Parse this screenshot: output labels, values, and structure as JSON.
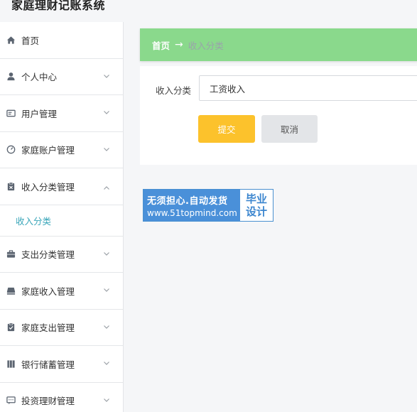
{
  "app": {
    "title": "家庭理财记账系统"
  },
  "sidebar": {
    "items": [
      {
        "label": "首页",
        "icon": "home-icon",
        "has_arrow": false
      },
      {
        "label": "个人中心",
        "icon": "user-icon",
        "has_arrow": true
      },
      {
        "label": "用户管理",
        "icon": "id-card-icon",
        "has_arrow": true
      },
      {
        "label": "家庭账户管理",
        "icon": "gauge-icon",
        "has_arrow": true
      },
      {
        "label": "收入分类管理",
        "icon": "clipboard-icon",
        "has_arrow": true,
        "expanded": true,
        "children": [
          {
            "label": "收入分类"
          }
        ]
      },
      {
        "label": "支出分类管理",
        "icon": "briefcase-icon",
        "has_arrow": true
      },
      {
        "label": "家庭收入管理",
        "icon": "inbox-icon",
        "has_arrow": true
      },
      {
        "label": "家庭支出管理",
        "icon": "clipboard-check-icon",
        "has_arrow": true
      },
      {
        "label": "银行储蓄管理",
        "icon": "book-icon",
        "has_arrow": true
      },
      {
        "label": "投资理财管理",
        "icon": "chat-icon",
        "has_arrow": true
      }
    ]
  },
  "breadcrumb": {
    "home": "首页",
    "separator": "→",
    "current": "收入分类"
  },
  "form": {
    "field_label": "收入分类",
    "field_value": "工资收入",
    "submit_label": "提交",
    "cancel_label": "取消"
  },
  "watermark": {
    "line1": "无须担心.自动发货",
    "line2": "www.51topmind.com",
    "badge_line1": "毕业",
    "badge_line2": "设计"
  },
  "colors": {
    "breadcrumb_bg": "#8ad98c",
    "submit_bg": "#fcc22c",
    "cancel_bg": "#e3e5e8",
    "active_sub_text": "#3aa6b9",
    "watermark_blue": "#4a90d9"
  }
}
